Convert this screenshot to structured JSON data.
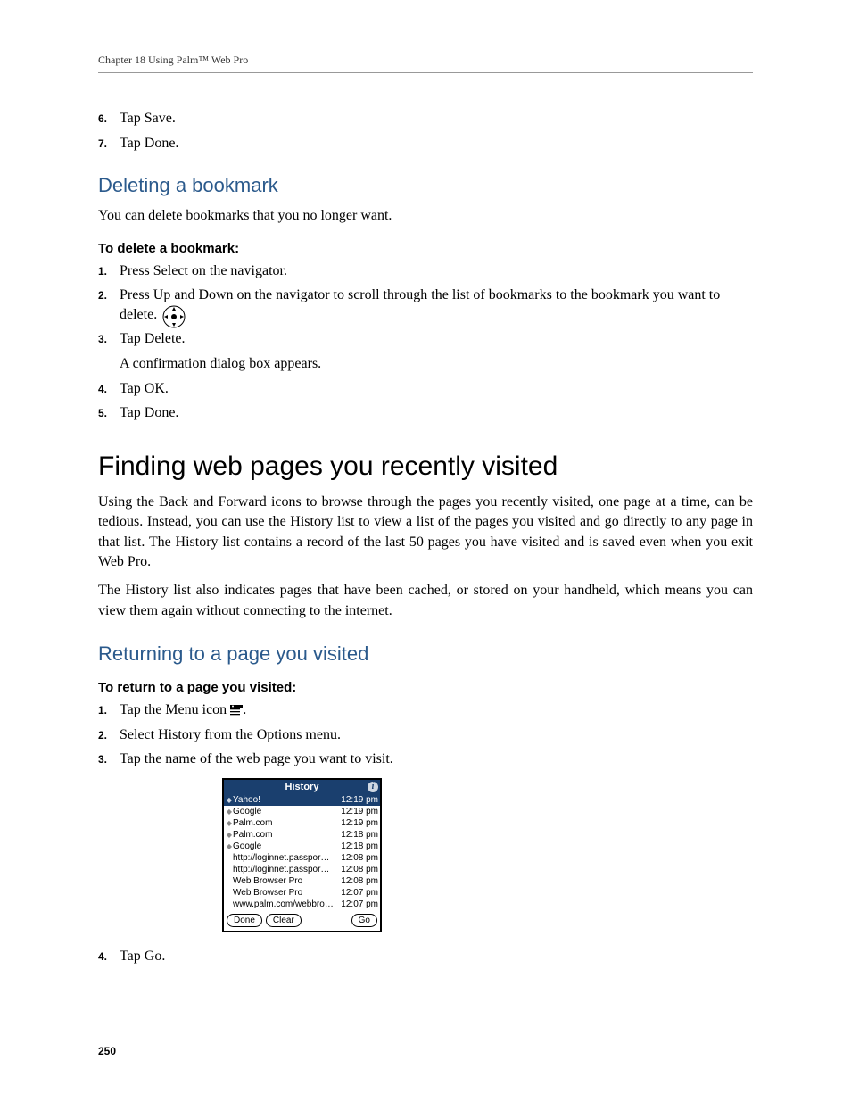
{
  "running_head": "Chapter 18   Using Palm™ Web Pro",
  "top_steps": [
    {
      "n": "6.",
      "t": "Tap Save."
    },
    {
      "n": "7.",
      "t": "Tap Done."
    }
  ],
  "sec1": {
    "heading": "Deleting a bookmark",
    "intro": "You can delete bookmarks that you no longer want.",
    "proc_head": "To delete a bookmark:",
    "steps": [
      {
        "n": "1.",
        "t": "Press Select on the navigator."
      },
      {
        "n": "2.",
        "t": "Press Up and Down on the navigator to scroll through the list of bookmarks to the bookmark you want to delete."
      },
      {
        "n": "3.",
        "t": "Tap Delete."
      },
      {
        "n": "",
        "t": "A confirmation dialog box appears."
      },
      {
        "n": "4.",
        "t": "Tap OK."
      },
      {
        "n": "5.",
        "t": "Tap Done."
      }
    ]
  },
  "sec2": {
    "heading": "Finding web pages you recently visited",
    "p1": "Using the Back and Forward icons to browse through the pages you recently visited, one page at a time, can be tedious. Instead, you can use the History list to view a list of the pages you visited and go directly to any page in that list. The History list contains a record of the last 50 pages you have visited and is saved even when you exit Web Pro.",
    "p2": "The History list also indicates pages that have been cached, or stored on your handheld, which means you can view them again without connecting to the internet."
  },
  "sec3": {
    "heading": "Returning to a page you visited",
    "proc_head": "To return to a page you visited:",
    "steps_a": [
      {
        "n": "1.",
        "pre": "Tap the Menu icon ",
        "post": "."
      },
      {
        "n": "2.",
        "t": "Select History from the Options menu."
      },
      {
        "n": "3.",
        "t": "Tap the name of the web page you want to visit."
      }
    ],
    "steps_b": [
      {
        "n": "4.",
        "t": "Tap Go."
      }
    ]
  },
  "history_dialog": {
    "title": "History",
    "rows": [
      {
        "icon": true,
        "sel": true,
        "name": "Yahoo!",
        "time": "12:19 pm"
      },
      {
        "icon": true,
        "sel": false,
        "name": "Google",
        "time": "12:19 pm"
      },
      {
        "icon": true,
        "sel": false,
        "name": "Palm.com",
        "time": "12:19 pm"
      },
      {
        "icon": true,
        "sel": false,
        "name": "Palm.com",
        "time": "12:18 pm"
      },
      {
        "icon": true,
        "sel": false,
        "name": "Google",
        "time": "12:18 pm"
      },
      {
        "icon": false,
        "sel": false,
        "name": "http://loginnet.passpor…",
        "time": "12:08 pm"
      },
      {
        "icon": false,
        "sel": false,
        "name": "http://loginnet.passpor…",
        "time": "12:08 pm"
      },
      {
        "icon": false,
        "sel": false,
        "name": "Web Browser Pro",
        "time": "12:08 pm"
      },
      {
        "icon": false,
        "sel": false,
        "name": "Web Browser Pro",
        "time": "12:07 pm"
      },
      {
        "icon": false,
        "sel": false,
        "name": "www.palm.com/webbro…",
        "time": "12:07 pm"
      }
    ],
    "buttons": {
      "done": "Done",
      "clear": "Clear",
      "go": "Go"
    }
  },
  "page_number": "250"
}
